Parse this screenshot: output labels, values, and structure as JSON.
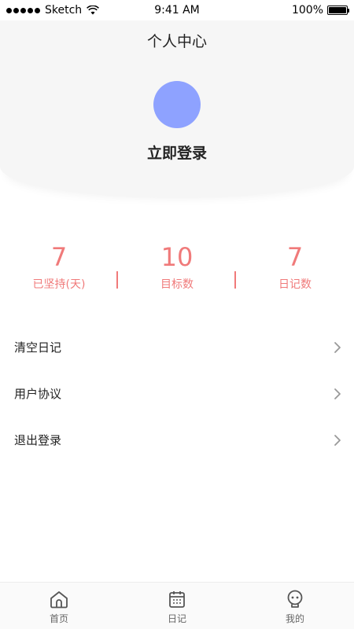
{
  "status_bar": {
    "carrier": "Sketch",
    "time": "9:41 AM",
    "battery": "100%"
  },
  "header": {
    "title": "个人中心"
  },
  "profile": {
    "login_label": "立即登录",
    "avatar_color": "#8ea2ff"
  },
  "stats": [
    {
      "value": "7",
      "label": "已坚持(天)"
    },
    {
      "value": "10",
      "label": "目标数"
    },
    {
      "value": "7",
      "label": "日记数"
    }
  ],
  "accent_color": "#f07a7a",
  "menu": [
    {
      "label": "清空日记",
      "icon": "chevron-right-icon"
    },
    {
      "label": "用户协议",
      "icon": "chevron-right-icon"
    },
    {
      "label": "退出登录",
      "icon": "chevron-right-icon"
    }
  ],
  "tabs": [
    {
      "label": "首页",
      "icon": "home-icon"
    },
    {
      "label": "日记",
      "icon": "calendar-icon"
    },
    {
      "label": "我的",
      "icon": "robot-icon"
    }
  ]
}
